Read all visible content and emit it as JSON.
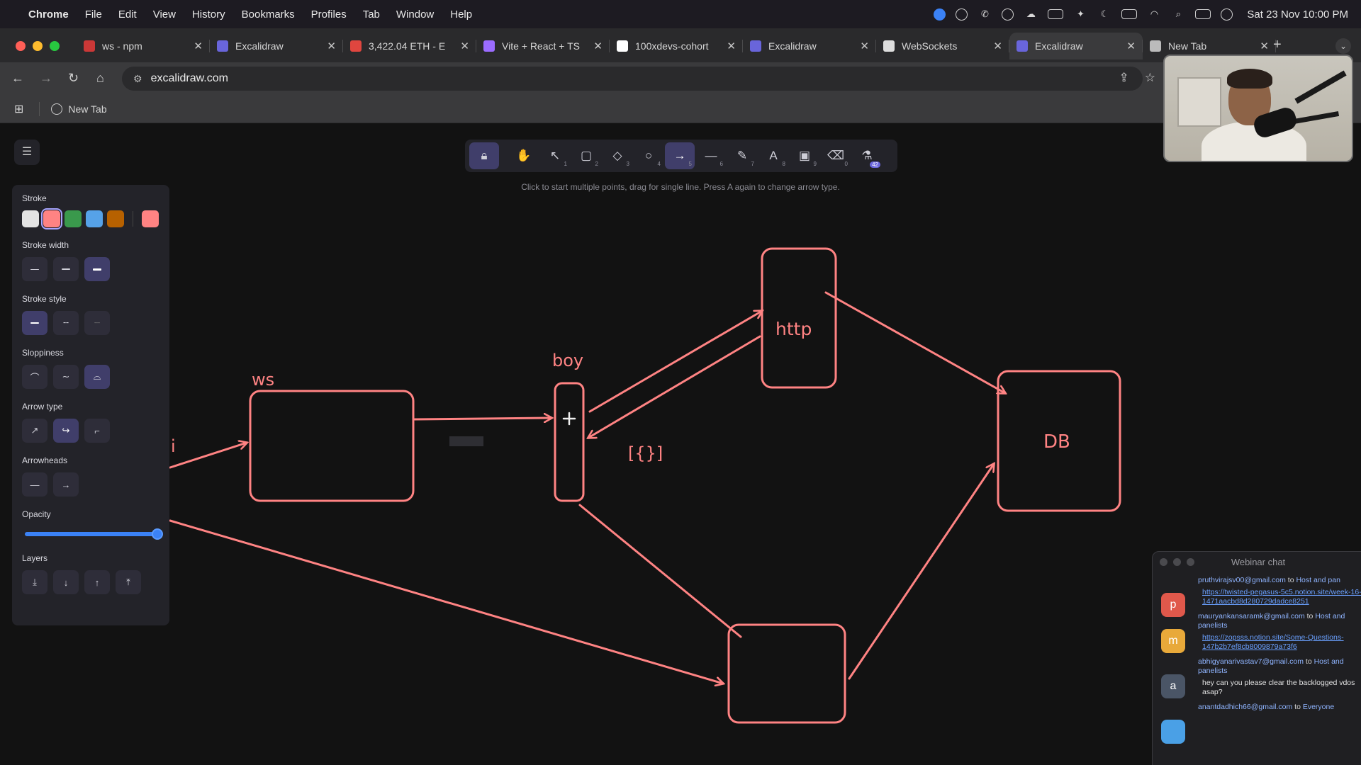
{
  "menubar": {
    "app": "Chrome",
    "items": [
      "File",
      "Edit",
      "View",
      "History",
      "Bookmarks",
      "Profiles",
      "Tab",
      "Window",
      "Help"
    ],
    "clock": "Sat 23 Nov  10:00 PM"
  },
  "tabs": [
    {
      "label": "ws - npm",
      "icon_color": "#cb3837"
    },
    {
      "label": "Excalidraw",
      "icon_color": "#6965db"
    },
    {
      "label": "3,422.04 ETH - E",
      "icon_color": "#e0463f"
    },
    {
      "label": "Vite + React + TS",
      "icon_color": "#9b6cff"
    },
    {
      "label": "100xdevs-cohort",
      "icon_color": "#ffffff"
    },
    {
      "label": "Excalidraw",
      "icon_color": "#6965db"
    },
    {
      "label": "WebSockets",
      "icon_color": "#dddddd"
    },
    {
      "label": "Excalidraw",
      "icon_color": "#6965db"
    },
    {
      "label": "New Tab",
      "icon_color": "#bbbbbb"
    }
  ],
  "active_tab_index": 7,
  "address": {
    "url": "excalidraw.com"
  },
  "bookmarks": {
    "items": [
      "New Tab"
    ]
  },
  "toolbar": {
    "hint": "Click to start multiple points, drag for single line. Press A again to change arrow type.",
    "tools": [
      {
        "name": "hand-tool",
        "glyph": "✋",
        "num": ""
      },
      {
        "name": "selection-tool",
        "glyph": "↖",
        "num": "1"
      },
      {
        "name": "rectangle-tool",
        "glyph": "▢",
        "num": "2"
      },
      {
        "name": "diamond-tool",
        "glyph": "◇",
        "num": "3"
      },
      {
        "name": "ellipse-tool",
        "glyph": "○",
        "num": "4"
      },
      {
        "name": "arrow-tool",
        "glyph": "→",
        "num": "5",
        "active": true
      },
      {
        "name": "line-tool",
        "glyph": "—",
        "num": "6"
      },
      {
        "name": "draw-tool",
        "glyph": "✎",
        "num": "7"
      },
      {
        "name": "text-tool",
        "glyph": "A",
        "num": "8"
      },
      {
        "name": "image-tool",
        "glyph": "▣",
        "num": "9"
      },
      {
        "name": "eraser-tool",
        "glyph": "⌫",
        "num": "0"
      },
      {
        "name": "library-tool",
        "glyph": "⚗",
        "num": "42"
      }
    ]
  },
  "properties": {
    "stroke_title": "Stroke",
    "stroke_colors": [
      "#e3e3e3",
      "#ff8383",
      "#3a994c",
      "#56a2e8",
      "#b76100"
    ],
    "stroke_selected": 1,
    "stroke_current": "#ff8383",
    "stroke_width_title": "Stroke width",
    "stroke_width_selected": 2,
    "stroke_style_title": "Stroke style",
    "stroke_style_selected": 0,
    "sloppiness_title": "Sloppiness",
    "sloppiness_selected": 2,
    "arrow_type_title": "Arrow type",
    "arrow_type_selected": 1,
    "arrowheads_title": "Arrowheads",
    "opacity_title": "Opacity",
    "opacity_value": 100,
    "layers_title": "Layers"
  },
  "canvas": {
    "stroke_color": "#ff8383",
    "labels": {
      "ws": "ws",
      "boy": "boy",
      "http": "http",
      "db": "DB",
      "brackets": "[{}]",
      "partial": "i"
    }
  },
  "chat": {
    "title": "Webinar chat",
    "messages": [
      {
        "from": "pruthvirajsv00@gmail.com",
        "to_label": " to ",
        "to": "Host and pan",
        "avatar": "p",
        "avatar_color": "#e0584b",
        "text": "https://twisted-pegasus-5c5.notion.site/week-16-1471aacbd8d280729dadce8251",
        "link": true
      },
      {
        "from": "mauryankansaramk@gmail.com",
        "to_label": " to ",
        "to": "Host and panelists",
        "avatar": "m",
        "avatar_color": "#e8a93a",
        "text": "https://zopsss.notion.site/Some-Questions-147b2b7ef8cb8009879a73f6",
        "link": true
      },
      {
        "from": "abhigyanarivastav7@gmail.com",
        "to_label": " to ",
        "to": "Host and panelists",
        "avatar": "a",
        "avatar_color": "#4a5566",
        "text": "hey can you please clear the backlogged vdos asap?",
        "link": false
      },
      {
        "from": "anantdadhich66@gmail.com",
        "to_label": " to ",
        "to": "Everyone",
        "avatar": "",
        "avatar_color": "#4aa0e6",
        "text": "",
        "link": false
      }
    ]
  }
}
